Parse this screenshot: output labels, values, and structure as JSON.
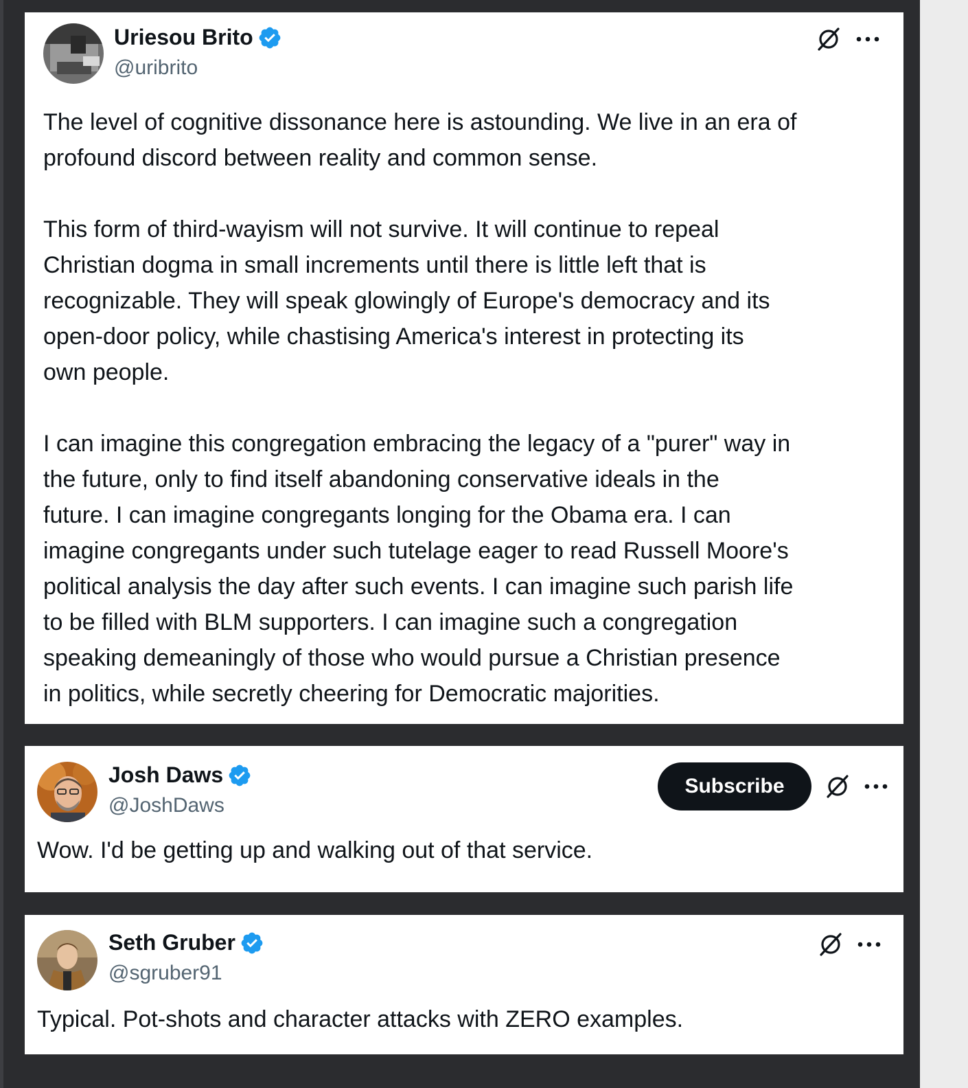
{
  "colors": {
    "background": "#2b2c2f",
    "card": "#ffffff",
    "text": "#0f1419",
    "handle": "#536471",
    "verified": "#1d9bf0",
    "subscribe_bg": "#0f1419"
  },
  "tweets": [
    {
      "author": {
        "name": "Uriesou Brito",
        "handle": "@uribrito",
        "verified": true,
        "avatar_icon": "avatar-photo"
      },
      "actions": {
        "grok_icon": "grok-icon",
        "more_icon": "more-icon"
      },
      "paragraphs": [
        "The level of cognitive dissonance here is astounding. We live in an era of\nprofound discord between reality and common sense.",
        "This form of third-wayism will not survive. It will continue to repeal\nChristian dogma in small increments until there is little left that is\nrecognizable. They will speak glowingly of Europe's democracy and its\nopen-door policy, while chastising America's interest in protecting its\nown people.",
        "I can imagine this congregation embracing the legacy of a \"purer\" way in\nthe future, only to find itself abandoning conservative ideals in the\nfuture. I can imagine congregants longing for the Obama era. I can\nimagine congregants under such tutelage eager to read Russell Moore's\npolitical analysis the day after such events. I can imagine such parish life\nto be filled with BLM supporters. I can imagine such a congregation\nspeaking demeaningly of those who would pursue a Christian presence\nin politics, while secretly cheering for Democratic majorities."
      ]
    },
    {
      "author": {
        "name": "Josh Daws",
        "handle": "@JoshDaws",
        "verified": true,
        "avatar_icon": "avatar-photo"
      },
      "actions": {
        "subscribe_label": "Subscribe",
        "grok_icon": "grok-icon",
        "more_icon": "more-icon"
      },
      "text": "Wow. I'd be getting up and walking out of that service."
    },
    {
      "author": {
        "name": "Seth Gruber",
        "handle": "@sgruber91",
        "verified": true,
        "avatar_icon": "avatar-photo"
      },
      "actions": {
        "grok_icon": "grok-icon",
        "more_icon": "more-icon"
      },
      "text": "Typical. Pot-shots and character attacks with ZERO examples."
    }
  ]
}
